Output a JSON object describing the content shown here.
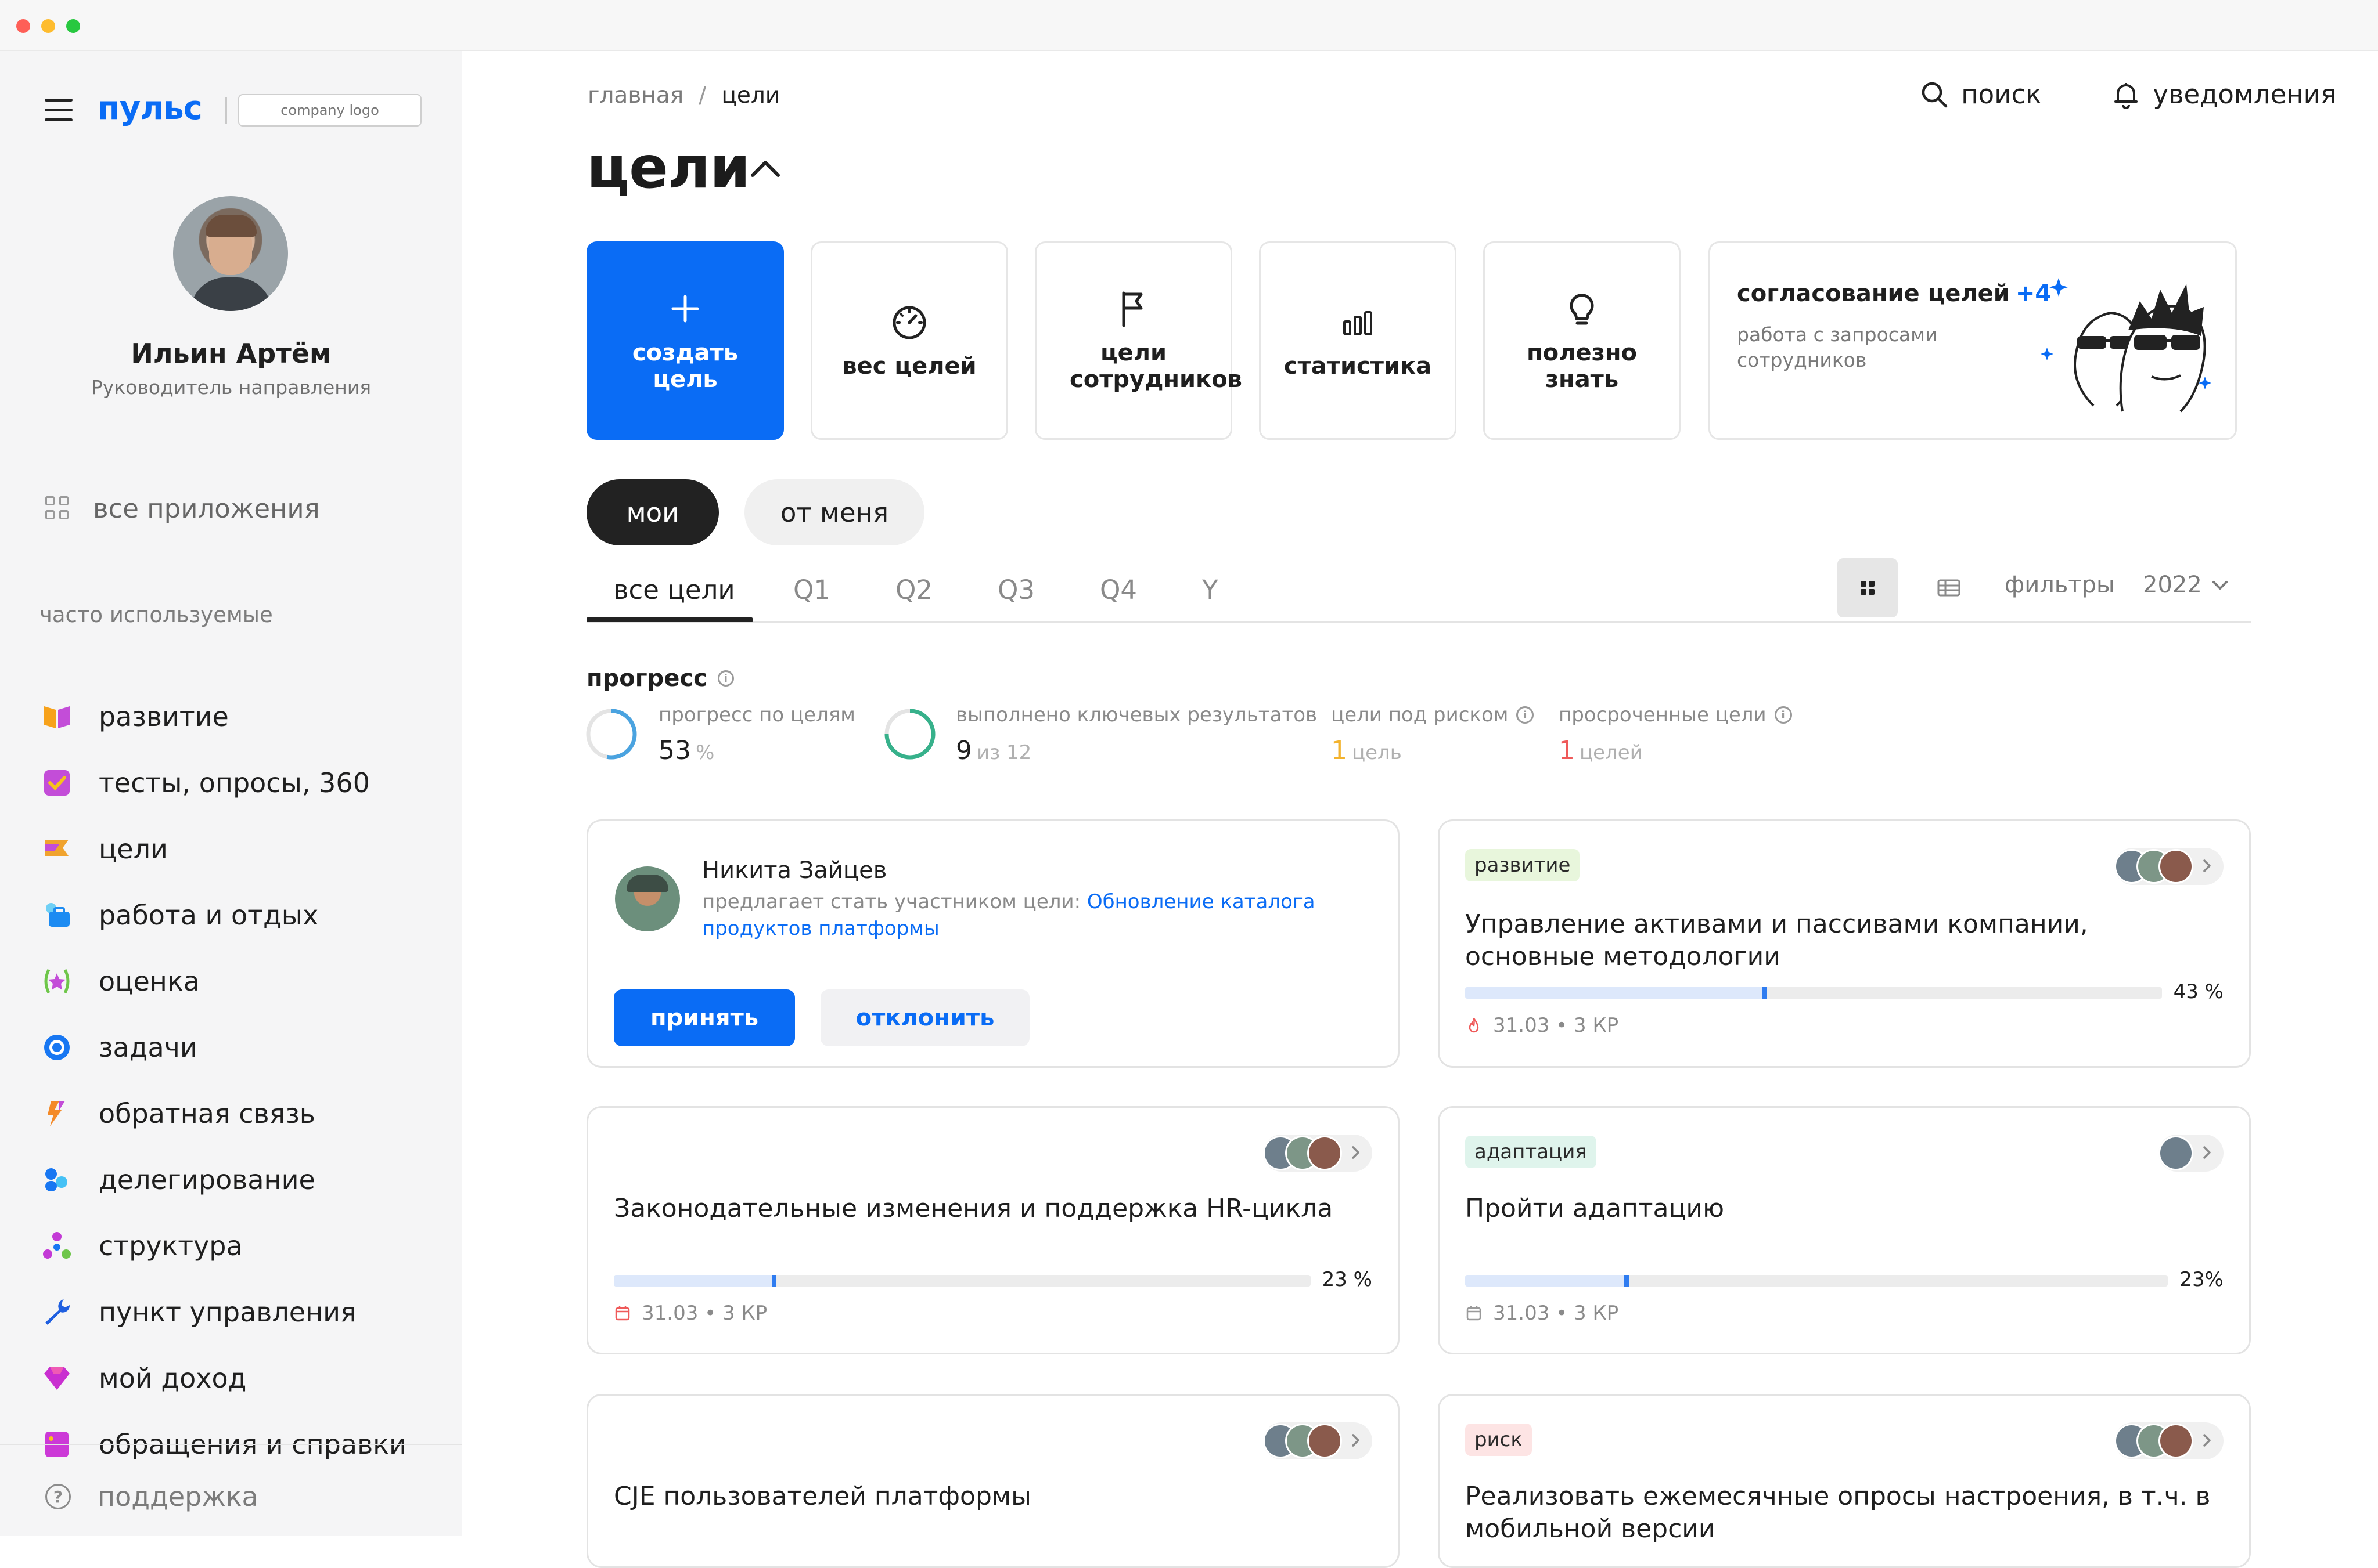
{
  "sidebar": {
    "logo_text": "пульс",
    "company_logo_text": "company logo",
    "user_name": "Ильин Артём",
    "user_role": "Руководитель направления",
    "all_apps_label": "все приложения",
    "frequent_label": "часто используемые",
    "items": [
      {
        "label": "развитие",
        "icon": "book-icon",
        "color": "#f7a21b"
      },
      {
        "label": "тесты, опросы, 360",
        "icon": "checkbox-icon",
        "color": "#c34dd8"
      },
      {
        "label": "цели",
        "icon": "flag-icon",
        "color": "#f0a32e"
      },
      {
        "label": "работа и отдых",
        "icon": "briefcase-icon",
        "color": "#1c8bf2"
      },
      {
        "label": "оценка",
        "icon": "star-icon",
        "color": "#6ec64a"
      },
      {
        "label": "задачи",
        "icon": "target-icon",
        "color": "#1877f2"
      },
      {
        "label": "обратная связь",
        "icon": "feedback-icon",
        "color": "#f48a28"
      },
      {
        "label": "делегирование",
        "icon": "people-icon",
        "color": "#1877f2"
      },
      {
        "label": "структура",
        "icon": "structure-icon",
        "color": "#c33ad6"
      },
      {
        "label": "пункт управления",
        "icon": "wrench-icon",
        "color": "#1f5fe0"
      },
      {
        "label": "мой доход",
        "icon": "diamond-icon",
        "color": "#c92fd0"
      },
      {
        "label": "обращения и справки",
        "icon": "document-icon",
        "color": "#cc39d7"
      }
    ],
    "support_label": "поддержка"
  },
  "header": {
    "breadcrumb": [
      "главная",
      "цели"
    ],
    "breadcrumb_sep": "/",
    "search_label": "поиск",
    "notifications_label": "уведомления",
    "title": "цели"
  },
  "tiles": [
    {
      "label": "создать цель",
      "icon": "plus-icon",
      "primary": true
    },
    {
      "label": "вес целей",
      "icon": "gauge-icon"
    },
    {
      "label": "цели сотрудников",
      "icon": "flag-icon"
    },
    {
      "label": "статистика",
      "icon": "bar-chart-icon"
    },
    {
      "label": "полезно знать",
      "icon": "lightbulb-icon"
    }
  ],
  "approval": {
    "title": "согласование целей",
    "count": "+4",
    "description": "работа с запросами сотрудников"
  },
  "segments": {
    "mine": "мои",
    "from_me": "от меня"
  },
  "tabs": [
    "все цели",
    "Q1",
    "Q2",
    "Q3",
    "Q4",
    "Y"
  ],
  "toolbar": {
    "filters_label": "фильтры",
    "year": "2022"
  },
  "progress": {
    "title": "прогресс",
    "stats": [
      {
        "label": "прогресс по целям",
        "value": "53",
        "unit": "%",
        "fraction": 0.53,
        "color": "#4aa3e0"
      },
      {
        "label": "выполнено ключевых результатов",
        "value": "9",
        "unit": "из 12",
        "fraction": 0.75,
        "color": "#37b18b"
      },
      {
        "label": "цели под риском",
        "value": "1",
        "unit": "цель",
        "value_color": "#f3b32e"
      },
      {
        "label": "просроченные цели",
        "value": "1",
        "unit": "целей",
        "value_color": "#ef5a5a"
      }
    ]
  },
  "invite": {
    "name": "Никита Зайцев",
    "text": "предлагает стать участником цели:",
    "goal_link": "Обновление каталога продуктов платформы",
    "accept_label": "принять",
    "decline_label": "отклонить"
  },
  "goals": [
    {
      "tag": "развитие",
      "title": "Управление активами и пассивами компании, основные методологии",
      "percent_label": "43 %",
      "progress": 0.43,
      "meta": "31.03 • 3 КР",
      "meta_icon": "fire-icon"
    },
    {
      "tag": "",
      "title": "Законодательные изменения и поддержка HR-цикла",
      "percent_label": "23 %",
      "progress": 0.23,
      "meta": "31.03 • 3 КР",
      "meta_icon": "calendar-icon"
    },
    {
      "tag": "адаптация",
      "title": "Пройти адаптацию",
      "percent_label": "23%",
      "progress": 0.23,
      "meta": "31.03 • 3 КР",
      "meta_icon": "calendar-icon"
    },
    {
      "tag": "",
      "title": "CJE пользователей платформы"
    },
    {
      "tag": "риск",
      "title": "Реализовать ежемесячные опросы настроения, в т.ч. в мобильной версии"
    }
  ]
}
